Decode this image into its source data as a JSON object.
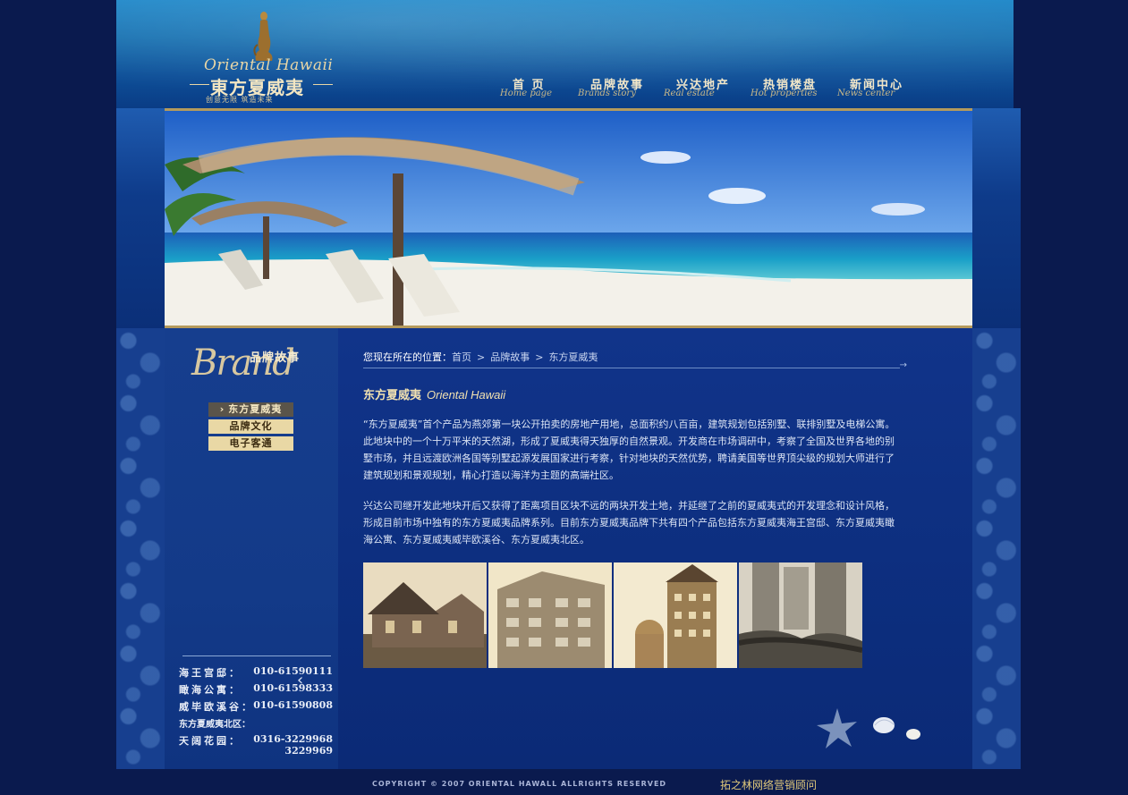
{
  "logo": {
    "en": "Oriental Hawaii",
    "cn": "東方夏威夷",
    "slogan": "创意无限 筑造未来"
  },
  "nav": [
    {
      "cn": "首 页",
      "en": "Home page"
    },
    {
      "cn": "品牌故事",
      "en": "Brands story"
    },
    {
      "cn": "兴达地产",
      "en": "Real estate"
    },
    {
      "cn": "热销楼盘",
      "en": "Hot properties"
    },
    {
      "cn": "新闻中心",
      "en": "News center"
    }
  ],
  "sidebar": {
    "brand_big": "Brand",
    "brand_cn": "品牌故事",
    "menu": [
      "东方夏威夷",
      "品牌文化",
      "电子客通"
    ],
    "contacts": [
      {
        "label": "海王宫邸：",
        "number": "010-61590111"
      },
      {
        "label": "瞰海公寓：",
        "number": "010-61598333"
      },
      {
        "label": "威毕欧溪谷：",
        "number": "010-61590808"
      },
      {
        "label": "东方夏威夷北区：",
        "number": ""
      },
      {
        "label": "天阔花园：",
        "number": "0316-3229968"
      },
      {
        "label": "",
        "number": "3229969"
      }
    ]
  },
  "breadcrumb": {
    "lead": "您现在所在的位置：",
    "items": [
      "首页",
      "品牌故事",
      "东方夏威夷"
    ],
    "sep": ">"
  },
  "main": {
    "title_cn": "东方夏威夷",
    "title_en": "Oriental Hawaii",
    "para1": "“东方夏威夷”首个产品为燕郊第一块公开拍卖的房地产用地，总面积约八百亩，建筑规划包括别墅、联排别墅及电梯公寓。此地块中的一个十万平米的天然湖，形成了夏威夷得天独厚的自然景观。开发商在市场调研中，考察了全国及世界各地的别墅市场，并且远渡欧洲各国等别墅起源发展国家进行考察，针对地块的天然优势，聘请美国等世界顶尖级的规划大师进行了建筑规划和景观规划，精心打造以海洋为主题的高端社区。",
    "para2": "兴达公司继开发此地块开后又获得了距离项目区块不远的两块开发土地，并延继了之前的夏威夷式的开发理念和设计风格，形成目前市场中独有的东方夏威夷品牌系列。目前东方夏威夷品牌下共有四个产品包括东方夏威夷海王宫邸、东方夏威夷瞰海公寓、东方夏威夷威毕欧溪谷、东方夏威夷北区。"
  },
  "footer": {
    "copyright": "COPYRIGHT © 2007 ORIENTAL HAWALL ALLRIGHTS RESERVED",
    "credit": "拓之林网络营销顾问"
  },
  "colors": {
    "background": "#0a1a4e",
    "accent_gold": "#e9d8a5",
    "text_light": "#dbe4f4"
  }
}
